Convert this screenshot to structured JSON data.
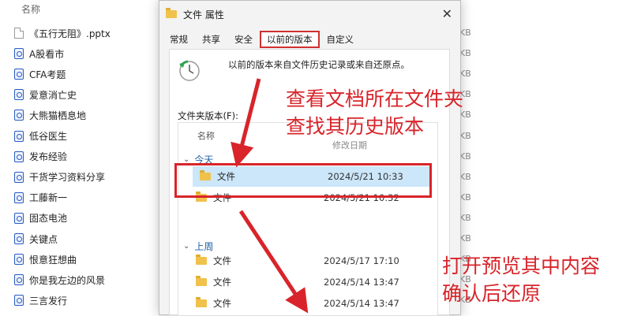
{
  "explorer": {
    "column_header": "名称",
    "files": [
      {
        "name": "《五行无阻》.pptx",
        "icon": "document-icon"
      },
      {
        "name": "A股看市",
        "icon": "shortcut-icon"
      },
      {
        "name": "CFA考题",
        "icon": "shortcut-icon"
      },
      {
        "name": "爱意消亡史",
        "icon": "shortcut-icon"
      },
      {
        "name": "大熊猫栖息地",
        "icon": "shortcut-icon"
      },
      {
        "name": "低谷医生",
        "icon": "shortcut-icon"
      },
      {
        "name": "发布经验",
        "icon": "shortcut-icon"
      },
      {
        "name": "干货学习资料分享",
        "icon": "shortcut-icon"
      },
      {
        "name": "工藤新一",
        "icon": "shortcut-icon"
      },
      {
        "name": "固态电池",
        "icon": "shortcut-icon"
      },
      {
        "name": "关键点",
        "icon": "shortcut-icon"
      },
      {
        "name": "恨意狂想曲",
        "icon": "shortcut-icon"
      },
      {
        "name": "你是我左边的风景",
        "icon": "shortcut-icon"
      },
      {
        "name": "三言发行",
        "icon": "shortcut-icon"
      }
    ],
    "size_unit": "KB"
  },
  "dialog": {
    "title": "文件 属性",
    "close_label": "✕",
    "tabs": [
      "常规",
      "共享",
      "安全",
      "以前的版本",
      "自定义"
    ],
    "active_tab": "以前的版本",
    "info_text": "以前的版本来自文件历史记录或来自还原点。",
    "versions_label": "文件夹版本(F):",
    "list_header_name": "名称",
    "list_header_date": "修改日期",
    "groups": [
      {
        "label": "今天",
        "rows": [
          {
            "name": "文件",
            "date": "2024/5/21 10:33",
            "selected": true
          },
          {
            "name": "文件",
            "date": "2024/5/21 10:32",
            "selected": false
          }
        ]
      },
      {
        "label": "上周",
        "rows": [
          {
            "name": "文件",
            "date": "2024/5/17 17:10",
            "selected": false
          },
          {
            "name": "文件",
            "date": "2024/5/14 13:47",
            "selected": false
          },
          {
            "name": "文件",
            "date": "2024/5/14 13:47",
            "selected": false
          }
        ]
      }
    ]
  },
  "annotations": {
    "top_note": [
      "查看文档所在文件夹",
      "查找其历史版本"
    ],
    "bottom_note": [
      "打开预览其中内容",
      "确认后还原"
    ],
    "color": "#d8242a"
  }
}
